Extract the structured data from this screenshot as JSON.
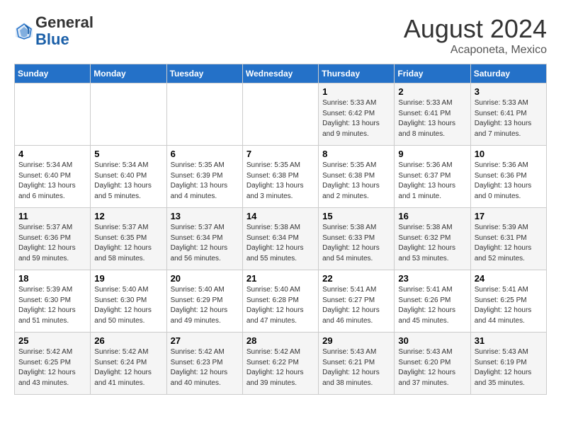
{
  "header": {
    "logo_line1": "General",
    "logo_line2": "Blue",
    "month_year": "August 2024",
    "location": "Acaponeta, Mexico"
  },
  "days_of_week": [
    "Sunday",
    "Monday",
    "Tuesday",
    "Wednesday",
    "Thursday",
    "Friday",
    "Saturday"
  ],
  "weeks": [
    {
      "days": [
        {
          "number": "",
          "info": ""
        },
        {
          "number": "",
          "info": ""
        },
        {
          "number": "",
          "info": ""
        },
        {
          "number": "",
          "info": ""
        },
        {
          "number": "1",
          "info": "Sunrise: 5:33 AM\nSunset: 6:42 PM\nDaylight: 13 hours\nand 9 minutes."
        },
        {
          "number": "2",
          "info": "Sunrise: 5:33 AM\nSunset: 6:41 PM\nDaylight: 13 hours\nand 8 minutes."
        },
        {
          "number": "3",
          "info": "Sunrise: 5:33 AM\nSunset: 6:41 PM\nDaylight: 13 hours\nand 7 minutes."
        }
      ]
    },
    {
      "days": [
        {
          "number": "4",
          "info": "Sunrise: 5:34 AM\nSunset: 6:40 PM\nDaylight: 13 hours\nand 6 minutes."
        },
        {
          "number": "5",
          "info": "Sunrise: 5:34 AM\nSunset: 6:40 PM\nDaylight: 13 hours\nand 5 minutes."
        },
        {
          "number": "6",
          "info": "Sunrise: 5:35 AM\nSunset: 6:39 PM\nDaylight: 13 hours\nand 4 minutes."
        },
        {
          "number": "7",
          "info": "Sunrise: 5:35 AM\nSunset: 6:38 PM\nDaylight: 13 hours\nand 3 minutes."
        },
        {
          "number": "8",
          "info": "Sunrise: 5:35 AM\nSunset: 6:38 PM\nDaylight: 13 hours\nand 2 minutes."
        },
        {
          "number": "9",
          "info": "Sunrise: 5:36 AM\nSunset: 6:37 PM\nDaylight: 13 hours\nand 1 minute."
        },
        {
          "number": "10",
          "info": "Sunrise: 5:36 AM\nSunset: 6:36 PM\nDaylight: 13 hours\nand 0 minutes."
        }
      ]
    },
    {
      "days": [
        {
          "number": "11",
          "info": "Sunrise: 5:37 AM\nSunset: 6:36 PM\nDaylight: 12 hours\nand 59 minutes."
        },
        {
          "number": "12",
          "info": "Sunrise: 5:37 AM\nSunset: 6:35 PM\nDaylight: 12 hours\nand 58 minutes."
        },
        {
          "number": "13",
          "info": "Sunrise: 5:37 AM\nSunset: 6:34 PM\nDaylight: 12 hours\nand 56 minutes."
        },
        {
          "number": "14",
          "info": "Sunrise: 5:38 AM\nSunset: 6:34 PM\nDaylight: 12 hours\nand 55 minutes."
        },
        {
          "number": "15",
          "info": "Sunrise: 5:38 AM\nSunset: 6:33 PM\nDaylight: 12 hours\nand 54 minutes."
        },
        {
          "number": "16",
          "info": "Sunrise: 5:38 AM\nSunset: 6:32 PM\nDaylight: 12 hours\nand 53 minutes."
        },
        {
          "number": "17",
          "info": "Sunrise: 5:39 AM\nSunset: 6:31 PM\nDaylight: 12 hours\nand 52 minutes."
        }
      ]
    },
    {
      "days": [
        {
          "number": "18",
          "info": "Sunrise: 5:39 AM\nSunset: 6:30 PM\nDaylight: 12 hours\nand 51 minutes."
        },
        {
          "number": "19",
          "info": "Sunrise: 5:40 AM\nSunset: 6:30 PM\nDaylight: 12 hours\nand 50 minutes."
        },
        {
          "number": "20",
          "info": "Sunrise: 5:40 AM\nSunset: 6:29 PM\nDaylight: 12 hours\nand 49 minutes."
        },
        {
          "number": "21",
          "info": "Sunrise: 5:40 AM\nSunset: 6:28 PM\nDaylight: 12 hours\nand 47 minutes."
        },
        {
          "number": "22",
          "info": "Sunrise: 5:41 AM\nSunset: 6:27 PM\nDaylight: 12 hours\nand 46 minutes."
        },
        {
          "number": "23",
          "info": "Sunrise: 5:41 AM\nSunset: 6:26 PM\nDaylight: 12 hours\nand 45 minutes."
        },
        {
          "number": "24",
          "info": "Sunrise: 5:41 AM\nSunset: 6:25 PM\nDaylight: 12 hours\nand 44 minutes."
        }
      ]
    },
    {
      "days": [
        {
          "number": "25",
          "info": "Sunrise: 5:42 AM\nSunset: 6:25 PM\nDaylight: 12 hours\nand 43 minutes."
        },
        {
          "number": "26",
          "info": "Sunrise: 5:42 AM\nSunset: 6:24 PM\nDaylight: 12 hours\nand 41 minutes."
        },
        {
          "number": "27",
          "info": "Sunrise: 5:42 AM\nSunset: 6:23 PM\nDaylight: 12 hours\nand 40 minutes."
        },
        {
          "number": "28",
          "info": "Sunrise: 5:42 AM\nSunset: 6:22 PM\nDaylight: 12 hours\nand 39 minutes."
        },
        {
          "number": "29",
          "info": "Sunrise: 5:43 AM\nSunset: 6:21 PM\nDaylight: 12 hours\nand 38 minutes."
        },
        {
          "number": "30",
          "info": "Sunrise: 5:43 AM\nSunset: 6:20 PM\nDaylight: 12 hours\nand 37 minutes."
        },
        {
          "number": "31",
          "info": "Sunrise: 5:43 AM\nSunset: 6:19 PM\nDaylight: 12 hours\nand 35 minutes."
        }
      ]
    }
  ]
}
